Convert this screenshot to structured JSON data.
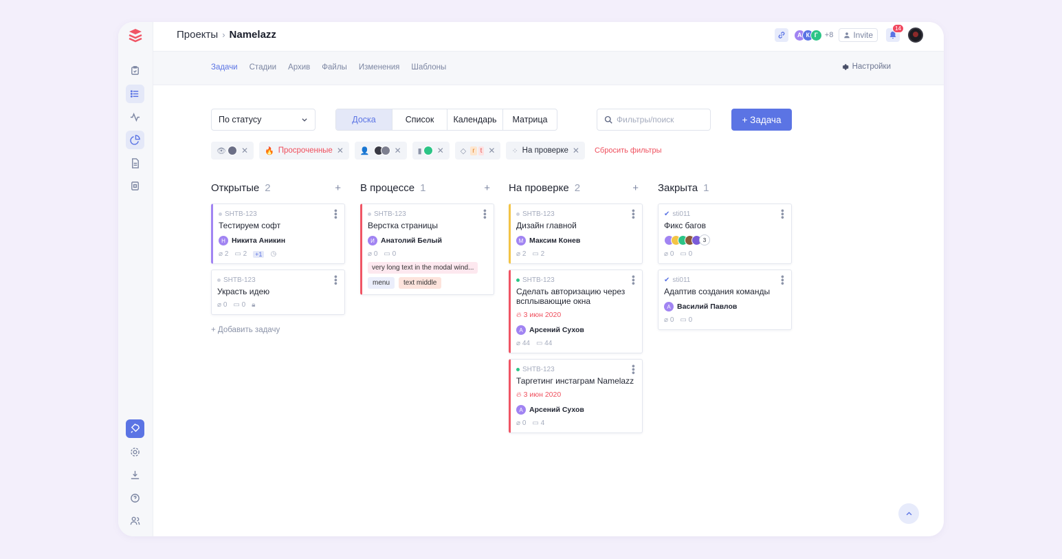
{
  "header": {
    "breadcrumb_root": "Проекты",
    "breadcrumb_sep": "›",
    "project": "Namelazz",
    "members": [
      "А",
      "К",
      "Г"
    ],
    "members_extra": "+8",
    "invite_label": "Invite",
    "notifications_count": "14"
  },
  "subnav": {
    "tabs": [
      "Задачи",
      "Стадии",
      "Архив",
      "Файлы",
      "Изменения",
      "Шаблоны"
    ],
    "active_tab": "Задачи",
    "settings_label": "Настройки"
  },
  "toolbar": {
    "group_by": "По статусу",
    "views": [
      "Доска",
      "Список",
      "Календарь",
      "Матрица"
    ],
    "active_view": "Доска",
    "search_placeholder": "Фильтры/поиск",
    "add_task_label": "+ Задача"
  },
  "filters": {
    "overdue_label": "Просроченные",
    "tag_r": "r",
    "tag_t": "t",
    "review_label": "На проверке",
    "reset_label": "Сбросить фильтры"
  },
  "columns": [
    {
      "title": "Открытые",
      "count": "2",
      "add_link": "+ Добавить задачу",
      "cards": [
        {
          "code": "SHTB-123",
          "title": "Тестируем софт",
          "assignee": "Никита Аникин",
          "initial": "Н",
          "attachments": "2",
          "comments": "2",
          "extra": "+1"
        },
        {
          "code": "SHTB-123",
          "title": "Украсть идею",
          "attachments": "0",
          "comments": "0"
        }
      ]
    },
    {
      "title": "В процессе",
      "count": "1",
      "cards": [
        {
          "code": "SHTB-123",
          "title": "Верстка страницы",
          "assignee": "Анатолий Белый",
          "initial": "И",
          "attachments": "0",
          "comments": "0",
          "note": "very long text in the modal wind...",
          "tags": [
            "menu",
            "text middle"
          ]
        }
      ]
    },
    {
      "title": "На проверке",
      "count": "2",
      "cards": [
        {
          "code": "SHTB-123",
          "title": "Дизайн главной",
          "assignee": "Максим Конев",
          "initial": "М",
          "attachments": "2",
          "comments": "2"
        },
        {
          "code": "SHTB-123",
          "title": "Сделать авторизацию через всплывающие окна",
          "due": "3 июн 2020",
          "assignee": "Арсений Сухов",
          "initial": "А",
          "attachments": "44",
          "comments": "44"
        },
        {
          "code": "SHTB-123",
          "title": "Таргетинг инстаграм Namelazz",
          "due": "3 июн 2020",
          "assignee": "Арсений Сухов",
          "initial": "А",
          "attachments": "0",
          "comments": "4"
        }
      ]
    },
    {
      "title": "Закрыта",
      "count": "1",
      "cards": [
        {
          "code": "sti011",
          "title": "Фикс багов",
          "more_count": "3",
          "attachments": "0",
          "comments": "0"
        },
        {
          "code": "sti011",
          "title": "Адаптив создания команды",
          "assignee": "Василий Павлов",
          "initial": "А",
          "attachments": "0",
          "comments": "0"
        }
      ]
    }
  ],
  "colors": {
    "accent": "#5b74e4",
    "danger": "#ef4e5c",
    "purple": "#a184f2",
    "yellow": "#f3c445"
  }
}
